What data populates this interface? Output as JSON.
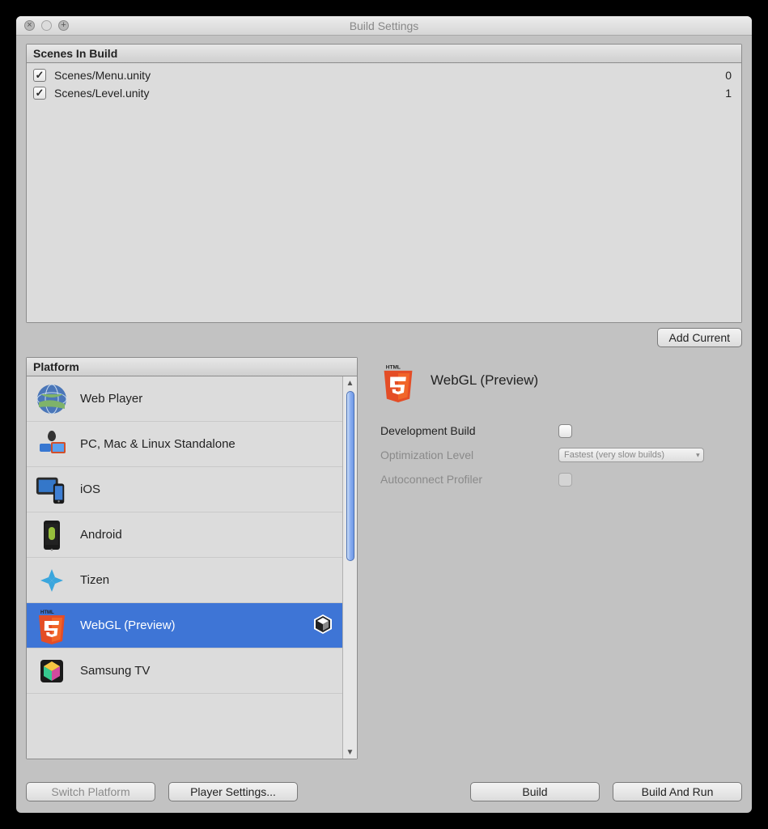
{
  "window": {
    "title": "Build Settings"
  },
  "scenes_panel": {
    "header": "Scenes In Build",
    "scenes": [
      {
        "checked": true,
        "path": "Scenes/Menu.unity",
        "index": "0"
      },
      {
        "checked": true,
        "path": "Scenes/Level.unity",
        "index": "1"
      }
    ],
    "add_button": "Add Current"
  },
  "platform_panel": {
    "header": "Platform",
    "items": [
      {
        "label": "Web Player",
        "icon": "globe",
        "selected": false
      },
      {
        "label": "PC, Mac & Linux Standalone",
        "icon": "desktop",
        "selected": false
      },
      {
        "label": "iOS",
        "icon": "ios",
        "selected": false
      },
      {
        "label": "Android",
        "icon": "android",
        "selected": false
      },
      {
        "label": "Tizen",
        "icon": "tizen",
        "selected": false
      },
      {
        "label": "WebGL (Preview)",
        "icon": "html5",
        "selected": true
      },
      {
        "label": "Samsung TV",
        "icon": "samsung",
        "selected": false
      }
    ]
  },
  "details": {
    "title": "WebGL (Preview)",
    "rows": {
      "dev_build": {
        "label": "Development Build",
        "checked": false,
        "disabled": false
      },
      "opt_level": {
        "label": "Optimization Level",
        "value": "Fastest (very slow builds)",
        "disabled": true
      },
      "autoconnect": {
        "label": "Autoconnect Profiler",
        "checked": false,
        "disabled": true
      }
    }
  },
  "buttons": {
    "switch_platform": "Switch Platform",
    "player_settings": "Player Settings...",
    "build": "Build",
    "build_and_run": "Build And Run"
  }
}
